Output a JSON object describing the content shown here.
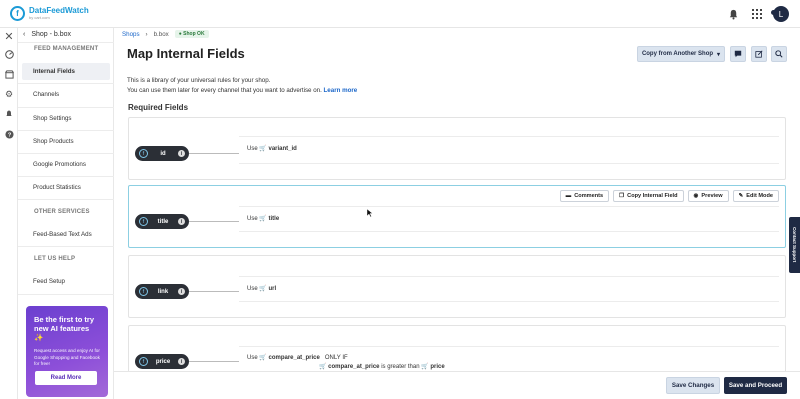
{
  "app": {
    "logo_name": "DataFeedWatch",
    "logo_sub": "by cart.com",
    "avatar_initial": "L"
  },
  "topbar": {
    "icons": [
      "bell-icon",
      "grid-icon"
    ]
  },
  "sidebar": {
    "back_label": "Shop - b.box",
    "feed_management_heading": "FEED MANAGEMENT",
    "items": [
      {
        "label": "Internal Fields",
        "active": true
      },
      {
        "label": "Channels"
      },
      {
        "label": "Shop Settings"
      },
      {
        "label": "Shop Products"
      },
      {
        "label": "Google Promotions"
      },
      {
        "label": "Product Statistics"
      }
    ],
    "other_services_heading": "OTHER SERVICES",
    "other_items": [
      {
        "label": "Feed-Based Text Ads"
      }
    ],
    "help_heading": "LET US HELP",
    "help_items": [
      {
        "label": "Feed Setup"
      }
    ],
    "promo": {
      "title": "Be the first to try new AI features ✨",
      "text": "Request access and enjoy AI for Google Shopping and Facebook for free!",
      "button": "Read More"
    }
  },
  "breadcrumb": {
    "shops": "Shops",
    "shop": "b.box",
    "status": "Shop OK"
  },
  "header": {
    "title": "Map Internal Fields",
    "copy_button": "Copy from Another Shop"
  },
  "intro": {
    "line1": "This is a library of your universal rules for your shop.",
    "line2": "You can use them later for every channel that you want to advertise on.",
    "learn_more": "Learn more"
  },
  "required_fields_title": "Required Fields",
  "fields": [
    {
      "name": "id",
      "use": "Use",
      "value": "variant_id"
    },
    {
      "name": "title",
      "use": "Use",
      "value": "title"
    },
    {
      "name": "link",
      "use": "Use",
      "value": "url"
    },
    {
      "name": "price",
      "use": "Use",
      "value": "compare_at_price",
      "condition": "ONLY IF",
      "cond_field": "compare_at_price",
      "cond_op": "is greater than",
      "cond_value": "price"
    }
  ],
  "card_actions": {
    "comments": "Comments",
    "copy": "Copy Internal Field",
    "preview": "Preview",
    "edit": "Edit Mode"
  },
  "footer": {
    "save_changes": "Save Changes",
    "save_proceed": "Save and Proceed"
  },
  "support_tab": "Contact Support",
  "colors": {
    "brand": "#1b9ad6",
    "navy": "#1f2a44",
    "promo": "#7b47d4"
  }
}
